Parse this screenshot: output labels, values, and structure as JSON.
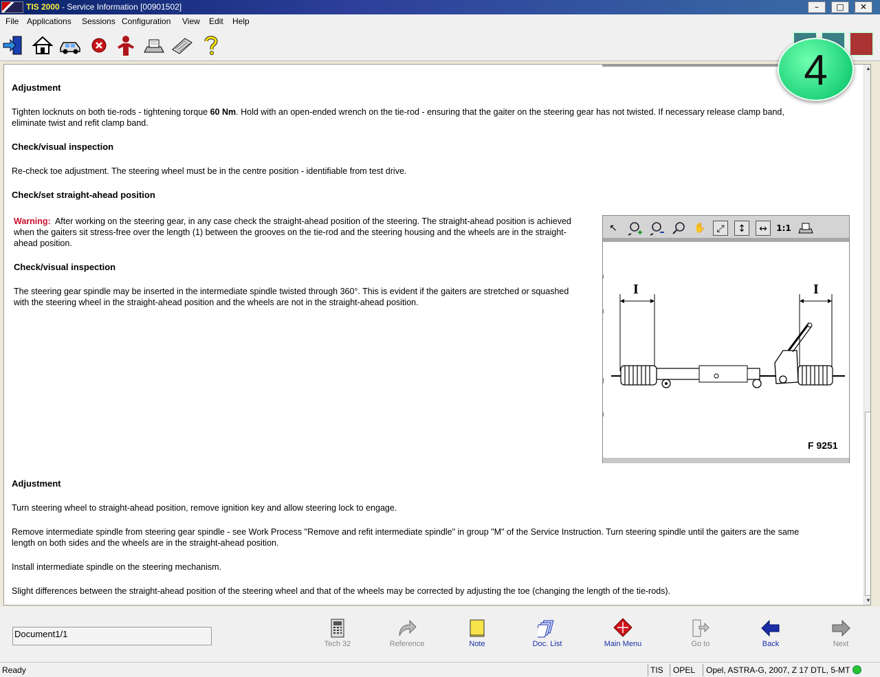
{
  "window": {
    "app_name": "TIS 2000",
    "title_rest": " - Service Information [00901502]",
    "minimize": "–",
    "maximize": "□",
    "close": "✕"
  },
  "menu": [
    "File",
    "Applications",
    "Sessions",
    "Configuration",
    "View",
    "Edit",
    "Help"
  ],
  "toolbar_icons": [
    "exit-icon",
    "home-icon",
    "vehicle-icon",
    "stop-icon",
    "person-icon",
    "printer-icon",
    "keyboard-icon",
    "help-icon"
  ],
  "badge": "4",
  "content": {
    "h1": "Adjustment",
    "p1_before": "Tighten locknuts on both tie-rods - tightening torque ",
    "p1_bold": "60 Nm",
    "p1_after": ". Hold with an open-ended wrench on the tie-rod - ensuring that the gaiter on the steering gear has not twisted. If necessary release clamp band,",
    "p1_line2": "eliminate twist and refit clamp band.",
    "h2": "Check/visual inspection",
    "p2": "Re-check toe adjustment. The steering wheel must be in the centre position - identifiable from test drive.",
    "h3": "Check/set straight-ahead position",
    "warning_label": "Warning:",
    "warning_line1": "After working on the steering gear, in any case check the straight-ahead position of the steering. The straight-ahead position is achieved",
    "warning_line2": "when the gaiters sit stress-free over the length (1) between the grooves on the tie-rod and the steering housing and the wheels are in the straight-",
    "warning_line3": "ahead position.",
    "h4": "Check/visual inspection",
    "p4_line1": "The steering gear spindle may be inserted in the intermediate spindle twisted through 360°. This is evident if the gaiters are stretched or squashed",
    "p4_line2": "with the steering wheel in the straight-ahead position and the wheels are not in the straight-ahead position.",
    "h5": "Adjustment",
    "p5": "Turn steering wheel to straight-ahead position, remove ignition key and allow steering lock to engage.",
    "p6_line1": "Remove intermediate spindle from steering gear spindle - see Work Process \"Remove and refit intermediate spindle\" in group \"M\" of the Service Instruction. Turn steering spindle until the gaiters are the same",
    "p6_line2": "length on both sides and the wheels are in the straight-ahead position.",
    "p7": "Install intermediate spindle on the steering mechanism.",
    "p8": "Slight differences between the straight-ahead position of the steering wheel and that of the wheels may be corrected by adjusting the toe (changing the length of the tie-rods)."
  },
  "viewer": {
    "ratio_label": "1:1",
    "dim_label_left": "I",
    "dim_label_right": "I",
    "figure_label": "F 9251"
  },
  "bottom": {
    "document_field": "Document1/1",
    "nav": [
      {
        "label": "Tech 32",
        "enabled": false
      },
      {
        "label": "Reference",
        "enabled": false
      },
      {
        "label": "Note",
        "enabled": true
      },
      {
        "label": "Doc. List",
        "enabled": true
      },
      {
        "label": "Main Menu",
        "enabled": true
      },
      {
        "label": "Go to",
        "enabled": false
      },
      {
        "label": "Back",
        "enabled": true
      },
      {
        "label": "Next",
        "enabled": false
      }
    ]
  },
  "status": {
    "ready": "Ready",
    "system": "TIS",
    "make": "OPEL",
    "vehicle": "Opel, ASTRA-G, 2007, Z 17 DTL, 5-MT"
  },
  "colors": {
    "warning": "#c8102e",
    "nav_enabled": "#1a2ea8",
    "badge": "#1fd37a"
  }
}
